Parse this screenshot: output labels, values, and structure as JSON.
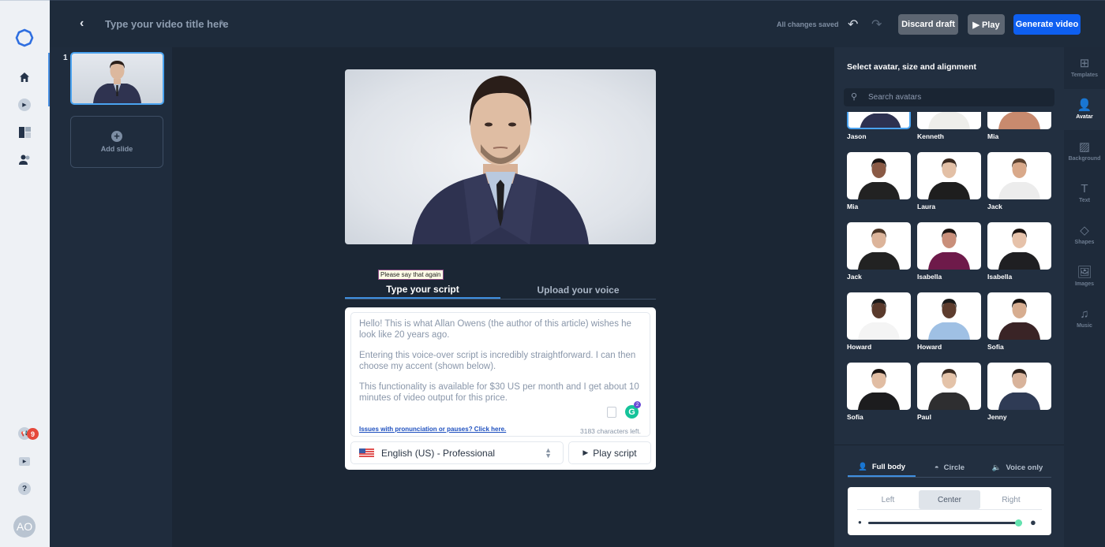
{
  "topbar": {
    "back_label": "‹",
    "video_title_placeholder": "Type your video title here",
    "edit_icon": "✎",
    "save_status": "All changes saved",
    "undo_icon": "↶",
    "redo_icon": "↷",
    "discard_label": "Discard draft",
    "play_label": "▶ Play",
    "generate_label": "Generate video",
    "accent_color": "#0e5ff0"
  },
  "left_rail": {
    "notification_count": "9",
    "user_initials": "AO"
  },
  "slides": {
    "items": [
      {
        "number": "1"
      }
    ],
    "add_slide_label": "Add slide",
    "add_icon": "+"
  },
  "editor": {
    "tooltip": "Please say that again",
    "tabs": [
      {
        "label": "Type your script",
        "active": true
      },
      {
        "label": "Upload your voice",
        "active": false
      }
    ],
    "script_paragraphs": [
      "Hello! This is what Allan Owens (the author of this article) wishes he look like 20 years ago.",
      "Entering this voice-over script is incredibly straightforward. I can then choose my accent (shown below).",
      "This functionality is available for $30 US per month and I get about 10 minutes of video output for this price."
    ],
    "pronunciation_link": "Issues with pronunciation or pauses? Click here.",
    "characters_left": "3183 characters left.",
    "grammarly_count": "2",
    "grammarly_letter": "G",
    "language_selected": "English (US) - Professional",
    "play_script_label": "Play script",
    "play_icon": "▶"
  },
  "avatar_panel": {
    "title": "Select avatar, size and alignment",
    "search_placeholder": "Search avatars",
    "avatars": [
      {
        "name": "Jason",
        "selected": true
      },
      {
        "name": "Kenneth"
      },
      {
        "name": "Mia"
      },
      {
        "name": "Mia"
      },
      {
        "name": "Laura"
      },
      {
        "name": "Jack"
      },
      {
        "name": "Jack"
      },
      {
        "name": "Isabella"
      },
      {
        "name": "Isabella"
      },
      {
        "name": "Howard"
      },
      {
        "name": "Howard"
      },
      {
        "name": "Sofia"
      },
      {
        "name": "Sofia"
      },
      {
        "name": "Paul"
      },
      {
        "name": "Jenny"
      }
    ],
    "modes": [
      {
        "label": "Full body",
        "active": true
      },
      {
        "label": "Circle"
      },
      {
        "label": "Voice only"
      }
    ],
    "alignment": [
      {
        "label": "Left"
      },
      {
        "label": "Center",
        "active": true
      },
      {
        "label": "Right"
      }
    ],
    "size_fraction": 1.0
  },
  "tools": [
    {
      "label": "Templates",
      "icon": "⊞"
    },
    {
      "label": "Avatar",
      "icon": "👤",
      "active": true
    },
    {
      "label": "Background",
      "icon": "▨"
    },
    {
      "label": "Text",
      "icon": "T"
    },
    {
      "label": "Shapes",
      "icon": "◇"
    },
    {
      "label": "Images",
      "icon": "🖼"
    },
    {
      "label": "Music",
      "icon": "♫"
    }
  ]
}
